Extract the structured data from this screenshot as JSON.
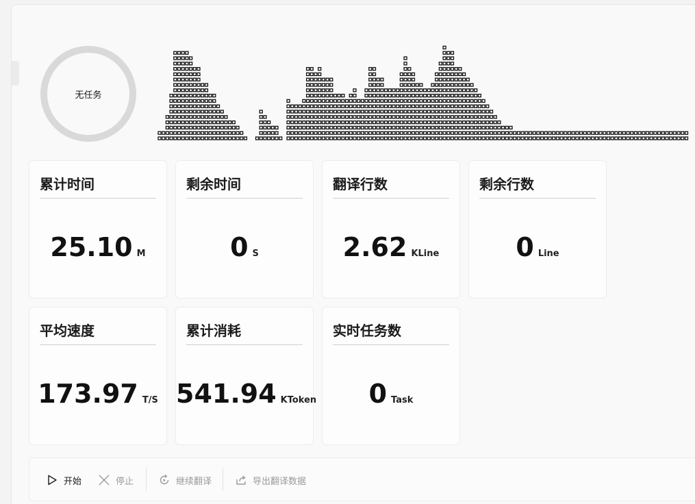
{
  "status": {
    "label": "无任务"
  },
  "cards": [
    {
      "title": "累计时间",
      "value": "25.10",
      "unit": "M"
    },
    {
      "title": "剩余时间",
      "value": "0",
      "unit": "S"
    },
    {
      "title": "翻译行数",
      "value": "2.62",
      "unit": "KLine"
    },
    {
      "title": "剩余行数",
      "value": "0",
      "unit": "Line"
    },
    {
      "title": "平均速度",
      "value": "173.97",
      "unit": "T/S"
    },
    {
      "title": "累计消耗",
      "value": "541.94",
      "unit": "KToken"
    },
    {
      "title": "实时任务数",
      "value": "0",
      "unit": "Task"
    }
  ],
  "toolbar": {
    "start_label": "开始",
    "stop_label": "停止",
    "continue_label": "继续翻译",
    "export_label": "导出翻译数据"
  },
  "waveform": {
    "levels": [
      2,
      2,
      5,
      9,
      17,
      17,
      17,
      17,
      16,
      14,
      14,
      11,
      11,
      9,
      9,
      7,
      6,
      5,
      4,
      4,
      3,
      2,
      1,
      0,
      0,
      1,
      6,
      5,
      4,
      3,
      3,
      1,
      0,
      8,
      7,
      7,
      7,
      8,
      14,
      14,
      13,
      14,
      12,
      12,
      12,
      9,
      9,
      9,
      8,
      9,
      10,
      8,
      8,
      10,
      14,
      14,
      12,
      12,
      10,
      10,
      10,
      10,
      13,
      16,
      14,
      13,
      11,
      11,
      10,
      10,
      11,
      13,
      15,
      18,
      17,
      17,
      14,
      14,
      13,
      12,
      11,
      10,
      9,
      8,
      7,
      6,
      5,
      4,
      3,
      3,
      3,
      2,
      2,
      2,
      2,
      2,
      2,
      2,
      2,
      2,
      2,
      2,
      2,
      2,
      2,
      2,
      2,
      2,
      2,
      2,
      2,
      2,
      2,
      2,
      2,
      2,
      2,
      2,
      2,
      2,
      2,
      2,
      2,
      2,
      2,
      2,
      2,
      2,
      2,
      2,
      2,
      2,
      2,
      2,
      2,
      2
    ]
  },
  "colors": {
    "accent": "#1a1a1a",
    "ring": "#d9d9d9",
    "disabled": "#9a9a9a"
  }
}
